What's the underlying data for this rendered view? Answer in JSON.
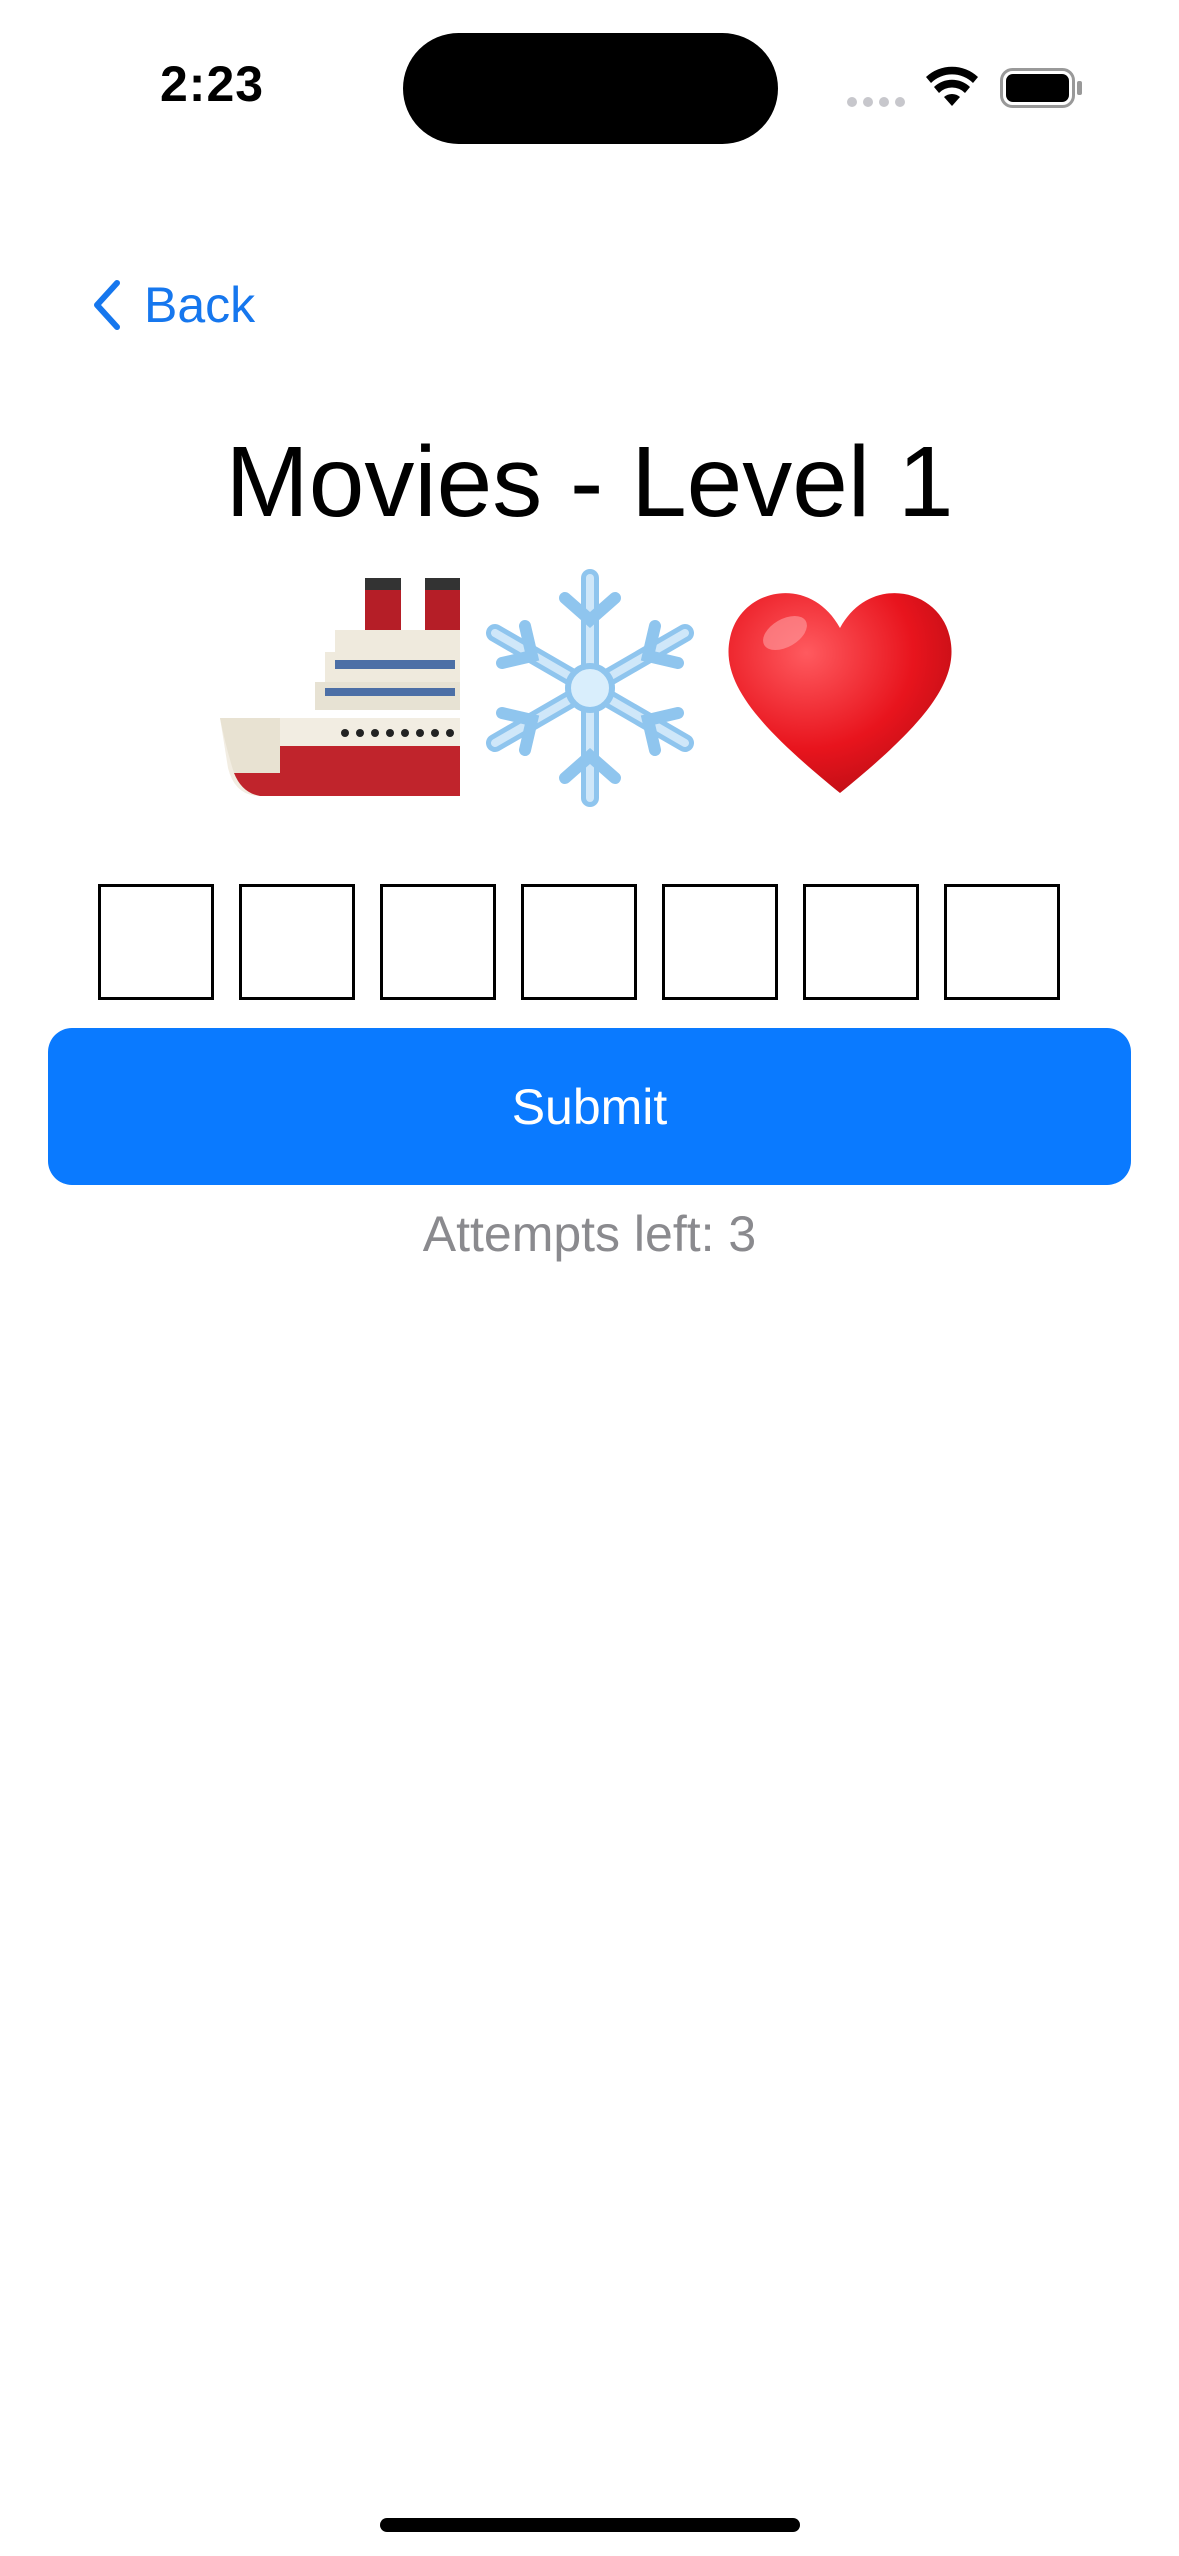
{
  "status_bar": {
    "time": "2:23",
    "icons": [
      "cellular-signal-icon",
      "wifi-icon",
      "battery-icon"
    ]
  },
  "nav": {
    "back_label": "Back",
    "back_icon": "chevron-left-icon"
  },
  "game": {
    "title": "Movies - Level 1",
    "clue_emojis": [
      {
        "name": "ship-emoji",
        "char": "🚢"
      },
      {
        "name": "snowflake-emoji",
        "char": "❄️"
      },
      {
        "name": "red-heart-emoji",
        "char": "❤️"
      }
    ],
    "answer_boxes": [
      "",
      "",
      "",
      "",
      "",
      "",
      ""
    ],
    "submit_label": "Submit",
    "attempts_text": "Attempts left: 3"
  },
  "colors": {
    "accent": "#0a7aff",
    "link": "#1677ee",
    "secondary_text": "#8a8a8e"
  }
}
